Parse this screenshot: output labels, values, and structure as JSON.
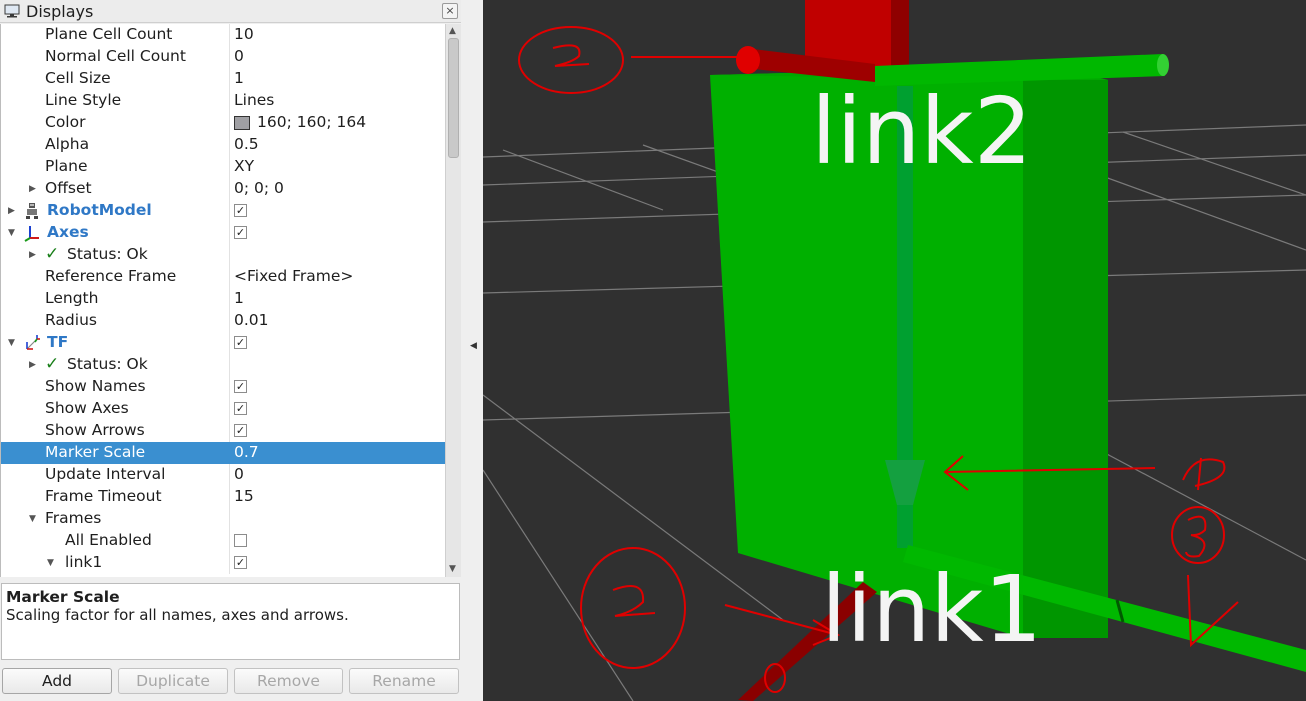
{
  "panel": {
    "title": "Displays",
    "close_glyph": "×",
    "title_icon": "monitor-icon"
  },
  "tree": {
    "rows": [
      {
        "label": "Plane Cell Count",
        "value": "10"
      },
      {
        "label": "Normal Cell Count",
        "value": "0"
      },
      {
        "label": "Cell Size",
        "value": "1"
      },
      {
        "label": "Line Style",
        "value": "Lines"
      },
      {
        "label": "Color",
        "value": "160; 160; 164"
      },
      {
        "label": "Alpha",
        "value": "0.5"
      },
      {
        "label": "Plane",
        "value": "XY"
      },
      {
        "label": "Offset",
        "value": "0; 0; 0"
      },
      {
        "label": "RobotModel",
        "checked": true
      },
      {
        "label": "Axes",
        "checked": true
      },
      {
        "label": "Status: Ok"
      },
      {
        "label": "Reference Frame",
        "value": "<Fixed Frame>"
      },
      {
        "label": "Length",
        "value": "1"
      },
      {
        "label": "Radius",
        "value": "0.01"
      },
      {
        "label": "TF",
        "checked": true
      },
      {
        "label": "Status: Ok"
      },
      {
        "label": "Show Names",
        "checked": true
      },
      {
        "label": "Show Axes",
        "checked": true
      },
      {
        "label": "Show Arrows",
        "checked": true
      },
      {
        "label": "Marker Scale",
        "value": "0.7",
        "selected": true
      },
      {
        "label": "Update Interval",
        "value": "0"
      },
      {
        "label": "Frame Timeout",
        "value": "15"
      },
      {
        "label": "Frames"
      },
      {
        "label": "All Enabled",
        "checked": false
      },
      {
        "label": "link1",
        "checked": true
      }
    ],
    "check_glyph": "✓",
    "ok_glyph": "✓",
    "expand_glyph": "▶",
    "collapse_glyph": "▼"
  },
  "description": {
    "title": "Marker Scale",
    "text": "Scaling factor for all names, axes and arrows."
  },
  "buttons": {
    "add": "Add",
    "duplicate": "Duplicate",
    "remove": "Remove",
    "rename": "Rename"
  },
  "view": {
    "link2_label": "link2",
    "link1_label": "link1",
    "background_color": "#303030",
    "box_color": "#00c000",
    "axis_red": "#b00000",
    "annotation_color": "#e00000"
  }
}
